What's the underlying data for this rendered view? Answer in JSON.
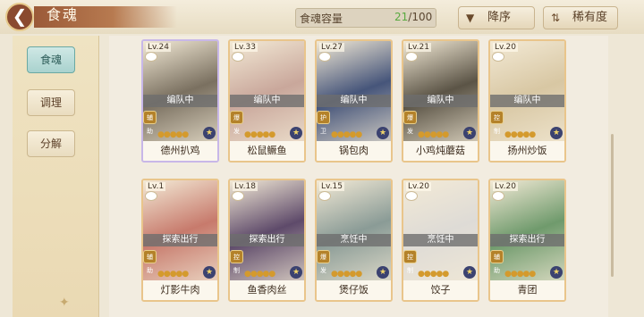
{
  "header": {
    "back_icon": "back-arrow-icon",
    "title": "食魂",
    "capacity_label": "食魂容量",
    "capacity_current": "21",
    "capacity_max": "/100",
    "sort_order_label": "降序",
    "sort_rarity_label": "稀有度"
  },
  "sidebar": {
    "tabs": [
      {
        "label": "食魂",
        "active": true
      },
      {
        "label": "调理",
        "active": false
      },
      {
        "label": "分解",
        "active": false
      }
    ]
  },
  "cards": [
    {
      "level": "Lv.24",
      "name": "德州扒鸡",
      "status": "编队中",
      "role": "辅助",
      "rarity": "rainbow",
      "art": "#7a7060"
    },
    {
      "level": "Lv.33",
      "name": "松鼠鳜鱼",
      "status": "编队中",
      "role": "爆发",
      "rarity": "gold",
      "art": "#c9a79b"
    },
    {
      "level": "Lv.27",
      "name": "锅包肉",
      "status": "编队中",
      "role": "护卫",
      "rarity": "gold",
      "art": "#46557a"
    },
    {
      "level": "Lv.21",
      "name": "小鸡炖蘑菇",
      "status": "编队中",
      "role": "爆发",
      "rarity": "gold",
      "art": "#5b5446"
    },
    {
      "level": "Lv.20",
      "name": "扬州炒饭",
      "status": "编队中",
      "role": "控制",
      "rarity": "gold",
      "art": "#d8c7a3"
    },
    {
      "level": "Lv.1",
      "name": "灯影牛肉",
      "status": "探索出行",
      "role": "辅助",
      "rarity": "gold",
      "art": "#c77a6c"
    },
    {
      "level": "Lv.18",
      "name": "鱼香肉丝",
      "status": "探索出行",
      "role": "控制",
      "rarity": "gold",
      "art": "#5e4a6a"
    },
    {
      "level": "Lv.15",
      "name": "煲仔饭",
      "status": "烹饪中",
      "role": "爆发",
      "rarity": "gold",
      "art": "#8a9b96"
    },
    {
      "level": "Lv.20",
      "name": "饺子",
      "status": "烹饪中",
      "role": "控制",
      "rarity": "gold",
      "art": "#dedbd6"
    },
    {
      "level": "Lv.20",
      "name": "青团",
      "status": "探索出行",
      "role": "辅助",
      "rarity": "gold",
      "art": "#6f9a6c"
    }
  ]
}
